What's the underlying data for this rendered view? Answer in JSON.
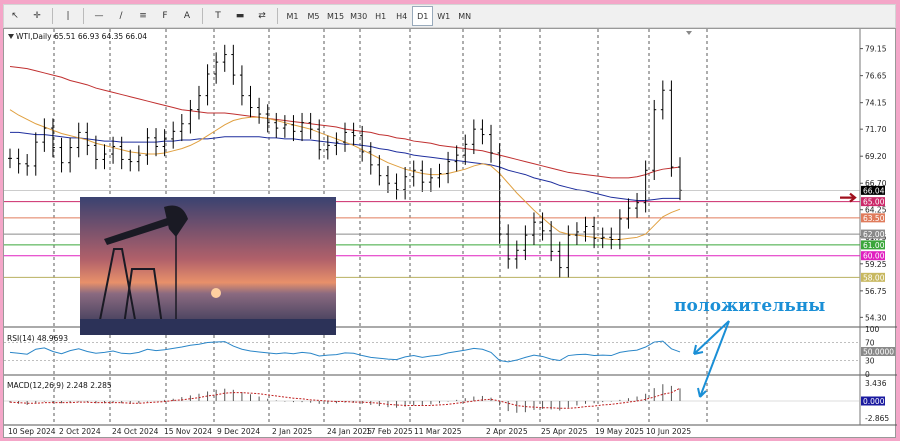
{
  "toolbar": {
    "tools": [
      {
        "name": "cursor-icon",
        "glyph": "↖"
      },
      {
        "name": "crosshair-icon",
        "glyph": "✛"
      },
      {
        "name": "vertical-line-icon",
        "glyph": "|"
      },
      {
        "name": "horizontal-line-icon",
        "glyph": "—"
      },
      {
        "name": "trendline-icon",
        "glyph": "∕"
      },
      {
        "name": "channel-icon",
        "glyph": "≡"
      },
      {
        "name": "fibonacci-icon",
        "glyph": "F"
      },
      {
        "name": "text-icon",
        "glyph": "A"
      },
      {
        "name": "label-icon",
        "glyph": "T"
      },
      {
        "name": "shapes-icon",
        "glyph": "▬"
      },
      {
        "name": "arrows-icon",
        "glyph": "⇄"
      }
    ],
    "timeframes": [
      "M1",
      "M5",
      "M15",
      "M30",
      "H1",
      "H4",
      "D1",
      "W1",
      "MN"
    ],
    "active_timeframe": "D1"
  },
  "header": {
    "symbol": "WTI,Daily",
    "ohlc": "65.51 66.93 64.35 66.04"
  },
  "rsi": {
    "label": "RSI(14) 48.9693",
    "scale": [
      "100",
      "70",
      "30",
      "0"
    ],
    "current_tag": "50.0000"
  },
  "macd": {
    "label": "MACD(12,26,9) 2.248 2.285",
    "scale": [
      "3.436",
      "-2.865"
    ],
    "zero_tag": "0.000"
  },
  "annotation": {
    "text": "положительны",
    "color": "#1a8fd6"
  },
  "chart_data": {
    "type": "line",
    "title": "",
    "price_axis": [
      "79.15",
      "76.65",
      "74.15",
      "71.70",
      "69.20",
      "66.70",
      "64.25",
      "61.75",
      "59.25",
      "56.75",
      "54.30"
    ],
    "x_ticks": [
      "10 Sep 2024",
      "2 Oct 2024",
      "24 Oct 2024",
      "15 Nov 2024",
      "9 Dec 2024",
      "2 Jan 2025",
      "24 Jan 2025",
      "17 Feb 2025",
      "11 Mar 2025",
      "2 Apr 2025",
      "25 Apr 2025",
      "19 May 2025",
      "10 Jun 2025"
    ],
    "current_price": {
      "value": 66.04,
      "label": "66.04",
      "color": "#000000"
    },
    "levels": [
      {
        "value": 65.0,
        "label": "65.00",
        "color": "#cc2a6a",
        "fill": "#cc2a6a"
      },
      {
        "value": 63.5,
        "label": "63.50",
        "color": "#e07c5c",
        "fill": "#e07c5c"
      },
      {
        "value": 62.0,
        "label": "62.00",
        "color": "#8a8a8a",
        "fill": "#8a8a8a"
      },
      {
        "value": 61.0,
        "label": "61.00",
        "color": "#3aa63a",
        "fill": "#3aa63a"
      },
      {
        "value": 60.0,
        "label": "60.00",
        "color": "#e020c0",
        "fill": "#e020c0"
      },
      {
        "value": 58.0,
        "label": "58.00",
        "color": "#b8b060",
        "fill": "#c8b860"
      }
    ],
    "series": [
      {
        "values": [
          69.0,
          68.5,
          68.3,
          70.5,
          71.8,
          70.0,
          68.6,
          70.0,
          71.4,
          70.2,
          68.9,
          69.4,
          70.1,
          68.9,
          68.7,
          69.3,
          70.9,
          70.1,
          70.8,
          71.5,
          72.2,
          73.5,
          74.8,
          76.8,
          77.9,
          78.6,
          76.7,
          74.8,
          73.7,
          73.1,
          72.3,
          71.8,
          72.1,
          71.5,
          72.3,
          71.7,
          69.8,
          70.2,
          70.5,
          71.4,
          71.1,
          69.6,
          68.4,
          67.4,
          66.7,
          66.1,
          67.3,
          67.9,
          66.8,
          67.2,
          67.6,
          68.7,
          69.3,
          70.3,
          71.7,
          71.2,
          69.5,
          62.0,
          59.7,
          60.5,
          61.9,
          63.1,
          62.3,
          60.4,
          58.9,
          61.9,
          62.2,
          62.7,
          61.6,
          61.7,
          61.5,
          63.4,
          64.4,
          64.9,
          67.9,
          73.5,
          75.3,
          68.2,
          66.04
        ]
      },
      {
        "values": [
          71.4,
          71.4,
          71.3,
          71.2,
          71.2,
          71.1,
          71.0,
          70.9,
          70.9,
          70.8,
          70.7,
          70.6,
          70.6,
          70.5,
          70.5,
          70.5,
          70.5,
          70.5,
          70.6,
          70.6,
          70.7,
          70.7,
          70.8,
          70.8,
          70.9,
          71.0,
          71.0,
          71.0,
          71.0,
          71.0,
          70.9,
          70.9,
          70.8,
          70.8,
          70.7,
          70.7,
          70.6,
          70.5,
          70.4,
          70.3,
          70.3,
          70.2,
          70.1,
          69.9,
          69.8,
          69.6,
          69.5,
          69.3,
          69.2,
          69.1,
          69.0,
          68.9,
          68.8,
          68.7,
          68.6,
          68.5,
          68.4,
          68.2,
          67.9,
          67.7,
          67.5,
          67.2,
          67.0,
          66.8,
          66.5,
          66.3,
          66.1,
          66.0,
          65.8,
          65.6,
          65.4,
          65.3,
          65.2,
          65.1,
          65.1,
          65.2,
          65.3,
          65.3,
          65.3
        ],
        "name": ""
      },
      {
        "values": [
          77.5,
          77.4,
          77.3,
          77.1,
          76.9,
          76.7,
          76.5,
          76.2,
          76.0,
          75.8,
          75.5,
          75.3,
          75.1,
          74.9,
          74.7,
          74.5,
          74.3,
          74.1,
          73.9,
          73.7,
          73.5,
          73.4,
          73.3,
          73.2,
          73.2,
          73.2,
          73.1,
          73.0,
          72.9,
          72.8,
          72.7,
          72.6,
          72.5,
          72.4,
          72.3,
          72.2,
          72.1,
          72.0,
          71.9,
          71.7,
          71.6,
          71.5,
          71.4,
          71.2,
          71.1,
          70.9,
          70.8,
          70.6,
          70.5,
          70.4,
          70.2,
          70.1,
          70.0,
          69.9,
          69.8,
          69.7,
          69.5,
          69.3,
          69.1,
          68.9,
          68.7,
          68.5,
          68.3,
          68.1,
          67.9,
          67.7,
          67.6,
          67.5,
          67.4,
          67.3,
          67.2,
          67.2,
          67.2,
          67.3,
          67.5,
          67.8,
          68.0,
          68.1,
          68.2
        ]
      },
      {
        "values": [
          73.5,
          73.0,
          72.6,
          72.2,
          71.9,
          71.6,
          71.3,
          71.1,
          70.9,
          70.7,
          70.4,
          70.2,
          70.0,
          69.8,
          69.6,
          69.5,
          69.4,
          69.4,
          69.5,
          69.7,
          69.9,
          70.2,
          70.6,
          71.1,
          71.6,
          72.1,
          72.5,
          72.7,
          72.8,
          72.8,
          72.7,
          72.5,
          72.3,
          72.1,
          71.9,
          71.7,
          71.4,
          71.1,
          70.8,
          70.5,
          70.2,
          69.8,
          69.4,
          69.0,
          68.6,
          68.3,
          68.0,
          67.8,
          67.6,
          67.5,
          67.5,
          67.6,
          67.8,
          68.0,
          68.3,
          68.5,
          68.3,
          67.6,
          66.7,
          65.8,
          65.0,
          64.2,
          63.5,
          62.8,
          62.2,
          62.0,
          61.9,
          61.8,
          61.7,
          61.6,
          61.5,
          61.5,
          61.6,
          61.7,
          62.0,
          62.8,
          63.6,
          64.0,
          64.3
        ]
      }
    ],
    "series_colors": [
      "#000000",
      "#1f2f9e",
      "#c03030",
      "#e0a040"
    ],
    "ylim": [
      53.5,
      80.5
    ],
    "rsi_values": [
      48,
      46,
      44,
      55,
      58,
      50,
      45,
      52,
      56,
      50,
      46,
      48,
      51,
      46,
      45,
      48,
      55,
      52,
      54,
      57,
      60,
      64,
      66,
      70,
      71,
      72,
      62,
      55,
      51,
      49,
      47,
      45,
      47,
      45,
      48,
      46,
      40,
      42,
      43,
      47,
      46,
      41,
      37,
      35,
      33,
      32,
      38,
      41,
      37,
      40,
      42,
      47,
      50,
      53,
      57,
      55,
      48,
      30,
      27,
      31,
      37,
      42,
      39,
      33,
      30,
      41,
      43,
      44,
      41,
      42,
      41,
      48,
      51,
      53,
      60,
      71,
      73,
      56,
      48.97
    ],
    "macd_hist": [
      -0.3,
      -0.5,
      -0.7,
      -0.4,
      -0.1,
      -0.2,
      -0.4,
      -0.3,
      -0.1,
      -0.2,
      -0.4,
      -0.4,
      -0.3,
      -0.4,
      -0.5,
      -0.4,
      -0.1,
      0.0,
      0.2,
      0.4,
      0.7,
      1.0,
      1.3,
      1.7,
      2.0,
      2.2,
      2.0,
      1.6,
      1.2,
      0.8,
      0.4,
      0.1,
      -0.1,
      -0.2,
      -0.2,
      -0.3,
      -0.5,
      -0.5,
      -0.4,
      -0.3,
      -0.3,
      -0.5,
      -0.7,
      -0.9,
      -1.1,
      -1.2,
      -1.0,
      -0.8,
      -0.8,
      -0.6,
      -0.4,
      -0.1,
      0.2,
      0.5,
      0.8,
      0.9,
      0.6,
      -0.8,
      -1.8,
      -2.1,
      -2.0,
      -1.6,
      -1.4,
      -1.5,
      -1.7,
      -1.2,
      -0.8,
      -0.5,
      -0.4,
      -0.2,
      -0.1,
      0.2,
      0.5,
      0.8,
      1.3,
      2.3,
      3.0,
      2.7,
      2.25
    ],
    "macd_signal": [
      -0.2,
      -0.3,
      -0.4,
      -0.4,
      -0.3,
      -0.3,
      -0.3,
      -0.3,
      -0.2,
      -0.2,
      -0.3,
      -0.3,
      -0.3,
      -0.3,
      -0.4,
      -0.4,
      -0.3,
      -0.2,
      -0.1,
      0.1,
      0.2,
      0.4,
      0.6,
      0.9,
      1.1,
      1.4,
      1.5,
      1.5,
      1.4,
      1.3,
      1.1,
      0.9,
      0.7,
      0.5,
      0.4,
      0.2,
      0.1,
      0.0,
      -0.1,
      -0.1,
      -0.2,
      -0.2,
      -0.3,
      -0.4,
      -0.6,
      -0.7,
      -0.8,
      -0.8,
      -0.8,
      -0.8,
      -0.7,
      -0.6,
      -0.4,
      -0.2,
      0.0,
      0.2,
      0.3,
      0.0,
      -0.4,
      -0.8,
      -1.0,
      -1.1,
      -1.2,
      -1.2,
      -1.3,
      -1.3,
      -1.2,
      -1.0,
      -0.9,
      -0.7,
      -0.6,
      -0.4,
      -0.2,
      0.0,
      0.3,
      0.7,
      1.2,
      1.5,
      2.285
    ]
  }
}
